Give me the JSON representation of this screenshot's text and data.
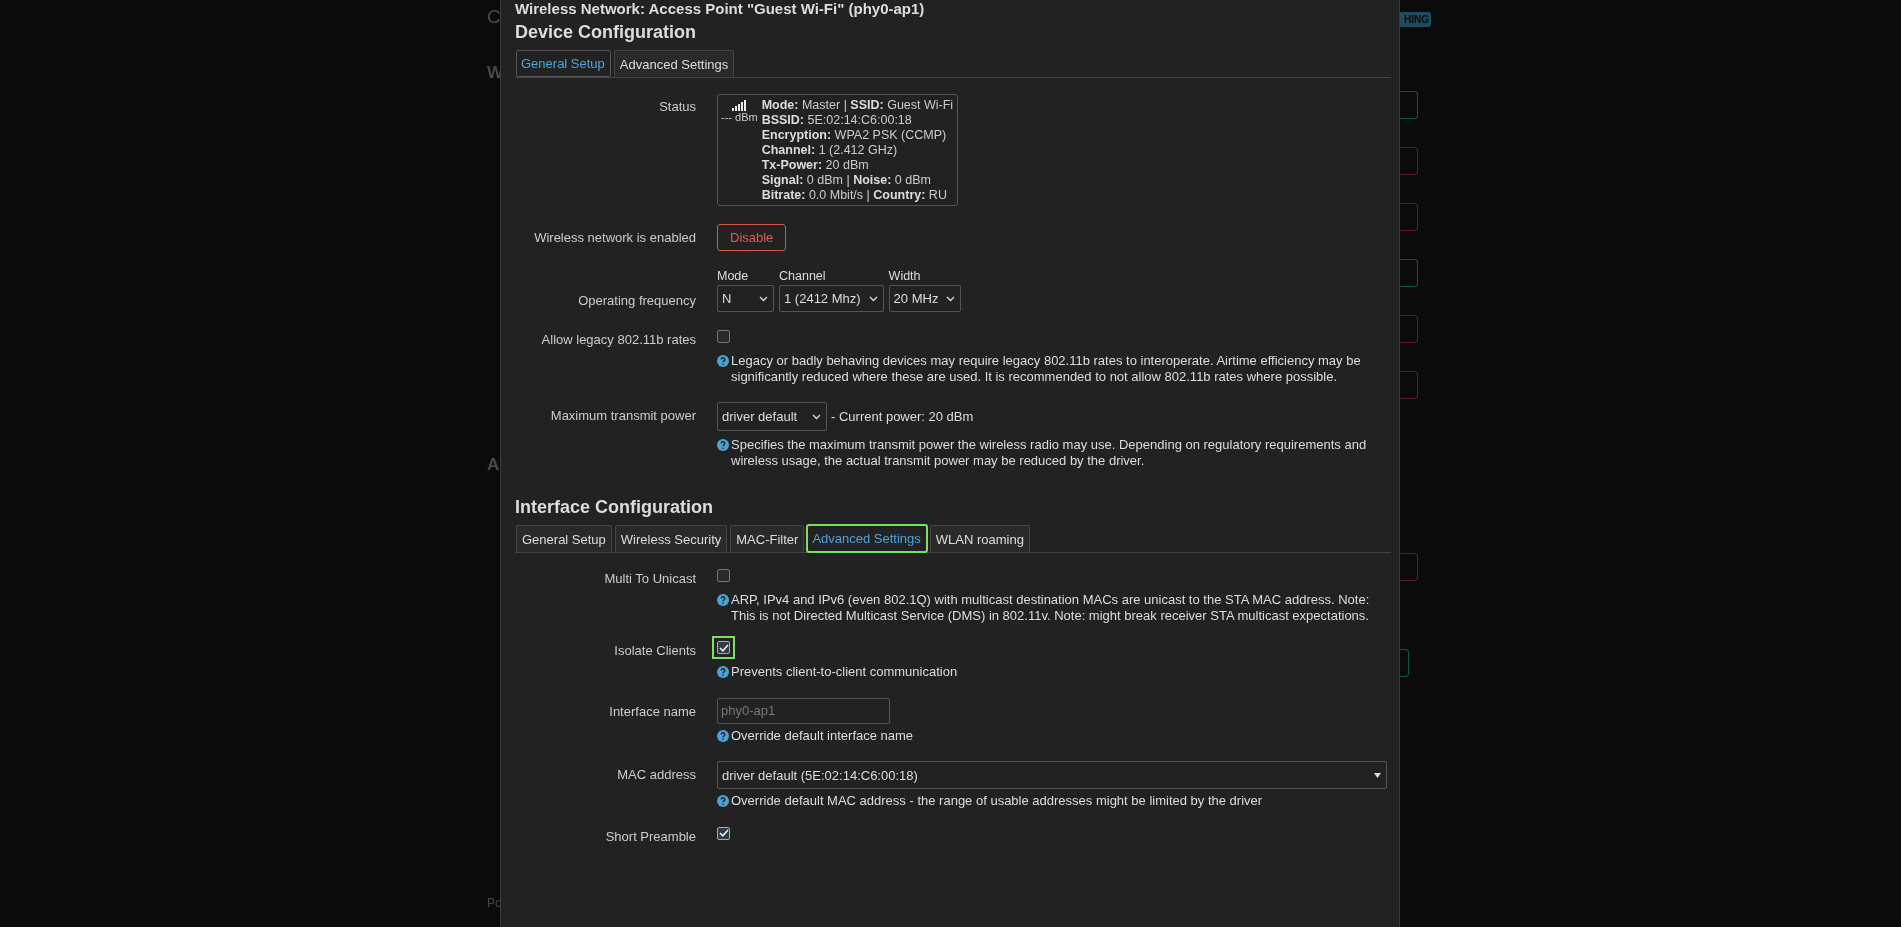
{
  "background": {
    "fragments": [
      "C",
      "W",
      "A",
      "Po"
    ],
    "badge": "HING",
    "buttons": [
      {
        "color": "#0f5a3c"
      },
      {
        "color": "#5a1f22"
      },
      {
        "color": "#5a1f22"
      },
      {
        "color": "#0f5a3c"
      },
      {
        "color": "#5a1f22"
      },
      {
        "color": "#5a1f22"
      },
      {
        "color": "#5a1f22"
      },
      {
        "color": "#0f5a3c"
      }
    ]
  },
  "modal": {
    "title": "Wireless Network: Access Point \"Guest Wi-Fi\" (phy0-ap1)",
    "sections": [
      {
        "heading": "Device Configuration",
        "tabs": [
          {
            "label": "General Setup",
            "selected": true,
            "highlighted": false
          },
          {
            "label": "Advanced Settings",
            "selected": false,
            "highlighted": false
          }
        ],
        "rows": [
          {
            "kind": "status",
            "label": "Status",
            "signal": "--- dBm",
            "lines": [
              "**Mode:** Master | **SSID:** Guest Wi-Fi",
              "**BSSID:** 5E:02:14:C6:00:18",
              "**Encryption:** WPA2 PSK (CCMP)",
              "**Channel:** 1 (2.412 GHz)",
              "**Tx-Power:** 20 dBm",
              "**Signal:** 0 dBm | **Noise:** 0 dBm",
              "**Bitrate:** 0.0 Mbit/s | **Country:** RU"
            ]
          },
          {
            "kind": "button",
            "label": "Wireless network is enabled",
            "button": "Disable"
          },
          {
            "kind": "frequency",
            "label": "Operating frequency",
            "selects": [
              {
                "label": "Mode",
                "value": "N"
              },
              {
                "label": "Channel",
                "value": "1 (2412 Mhz)"
              },
              {
                "label": "Width",
                "value": "20 MHz"
              }
            ]
          },
          {
            "kind": "checkbox",
            "label": "Allow legacy 802.11b rates",
            "checked": false,
            "highlighted": false,
            "help": "Legacy or badly behaving devices may require legacy 802.11b rates to interoperate. Airtime efficiency may be significantly reduced where these are used. It is recommended to not allow 802.11b rates where possible."
          },
          {
            "kind": "select",
            "label": "Maximum transmit power",
            "value": "driver default",
            "suffix": "- Current power: 20 dBm",
            "help": "Specifies the maximum transmit power the wireless radio may use. Depending on regulatory requirements and wireless usage, the actual transmit power may be reduced by the driver."
          }
        ]
      },
      {
        "heading": "Interface Configuration",
        "tabs": [
          {
            "label": "General Setup",
            "selected": false,
            "highlighted": false
          },
          {
            "label": "Wireless Security",
            "selected": false,
            "highlighted": false
          },
          {
            "label": "MAC-Filter",
            "selected": false,
            "highlighted": false
          },
          {
            "label": "Advanced Settings",
            "selected": true,
            "highlighted": true
          },
          {
            "label": "WLAN roaming",
            "selected": false,
            "highlighted": false
          }
        ],
        "rows": [
          {
            "kind": "checkbox",
            "label": "Multi To Unicast",
            "checked": false,
            "highlighted": false,
            "help": "ARP, IPv4 and IPv6 (even 802.1Q) with multicast destination MACs are unicast to the STA MAC address. Note: This is not Directed Multicast Service (DMS) in 802.11v. Note: might break receiver STA multicast expectations."
          },
          {
            "kind": "checkbox",
            "label": "Isolate Clients",
            "checked": true,
            "highlighted": true,
            "help": "Prevents client-to-client communication"
          },
          {
            "kind": "input",
            "label": "Interface name",
            "placeholder": "phy0-ap1",
            "help": "Override default interface name"
          },
          {
            "kind": "dropdown",
            "label": "MAC address",
            "value": "driver default (5E:02:14:C6:00:18)",
            "help": "Override default MAC address - the range of usable addresses might be limited by the driver"
          },
          {
            "kind": "checkbox",
            "label": "Short Preamble",
            "checked": true,
            "highlighted": false
          }
        ]
      }
    ]
  }
}
